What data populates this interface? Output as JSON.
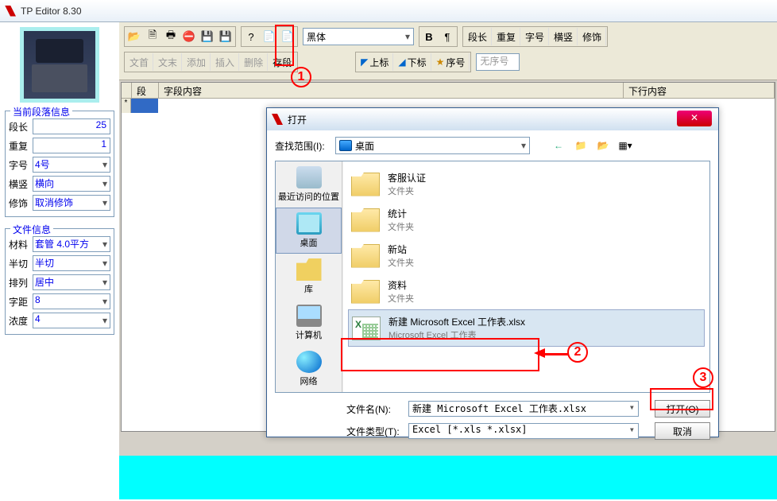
{
  "titlebar": {
    "title": "TP Editor  8.30"
  },
  "panel": {
    "section1_legend": "当前段落信息",
    "rows1": {
      "len_label": "段长",
      "len_value": "25",
      "repeat_label": "重复",
      "repeat_value": "1",
      "font_label": "字号",
      "font_value": "4号",
      "orient_label": "横竖",
      "orient_value": "横向",
      "deco_label": "修饰",
      "deco_value": "取消修饰"
    },
    "section2_legend": "文件信息",
    "rows2": {
      "material_label": "材料",
      "material_value": "套管 4.0平方",
      "half_label": "半切",
      "half_value": "半切",
      "align_label": "排列",
      "align_value": "居中",
      "spacing_label": "字距",
      "spacing_value": "8",
      "density_label": "浓度",
      "density_value": "4"
    }
  },
  "toolbar": {
    "font_combo": "黑体",
    "btns_text": {
      "duan_shou": "文首",
      "duan_wei": "文末",
      "tianjia": "添加",
      "charu": "插入",
      "shanchu": "删除",
      "cunduan": "存段",
      "shangbiao": "上标",
      "xiabiao": "下标",
      "xuhao": "序号",
      "wuxuhao": "无序号",
      "duanchang": "段长",
      "chongfu": "重复",
      "zihao": "字号",
      "hengshu": "横竖",
      "xiushi": "修饰"
    }
  },
  "grid": {
    "col1": "段号",
    "col2": "字段内容",
    "col3": "下行内容"
  },
  "dialog": {
    "title": "打开",
    "lookin_label": "查找范围(I):",
    "lookin_value": "桌面",
    "places": {
      "recent": "最近访问的位置",
      "desktop": "桌面",
      "lib": "库",
      "pc": "计算机",
      "net": "网络"
    },
    "files": [
      {
        "name": "客服认证",
        "type": "文件夹",
        "icon": "folder"
      },
      {
        "name": "统计",
        "type": "文件夹",
        "icon": "folder"
      },
      {
        "name": "新站",
        "type": "文件夹",
        "icon": "folder"
      },
      {
        "name": "资料",
        "type": "文件夹",
        "icon": "folder"
      },
      {
        "name": "新建 Microsoft Excel 工作表.xlsx",
        "type": "Microsoft Excel 工作表",
        "icon": "excel",
        "selected": true
      }
    ],
    "filename_label": "文件名(N):",
    "filename_value": "新建 Microsoft Excel 工作表.xlsx",
    "filetype_label": "文件类型(T):",
    "filetype_value": "Excel  [*.xls *.xlsx]",
    "open_btn": "打开(O)",
    "cancel_btn": "取消"
  },
  "callouts": {
    "c1": "1",
    "c2": "2",
    "c3": "3"
  }
}
